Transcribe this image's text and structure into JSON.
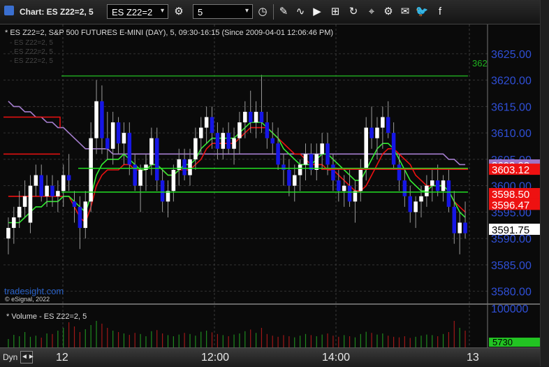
{
  "window": {
    "title": "Chart: ES Z22=2, 5"
  },
  "toolbar": {
    "symbol_value": "ES Z22=2",
    "interval_value": "5",
    "dropdown_glyph": "▾"
  },
  "chart": {
    "header": "* ES Z22=2, S&P 500 FUTURES E-MINI (DAY), 5, 09:30-16:15 (Since 2009-04-01 12:06:46 PM)",
    "faded_studies": [
      "- ES Z22=2, 5",
      "- ES Z22=2, 5",
      "- ES Z22=2, 5"
    ],
    "watermark": "tradesight.com",
    "copyright": "© eSignal, 2022",
    "green_line_tag": "362",
    "volume_header": "* Volume - ES Z22=2, 5",
    "volume_axis_label": "100000",
    "volume_last": "5730"
  },
  "price_tags": [
    {
      "text": "3603.93",
      "bg": "#a074c4",
      "fg": "#ffffff",
      "value": 3603.93
    },
    {
      "text": "3603.12",
      "bg": "#ee1111",
      "fg": "#ffffff",
      "value": 3603.12
    },
    {
      "text": "3598.50",
      "bg": "#ee1111",
      "fg": "#ffffff",
      "value": 3598.5
    },
    {
      "text": "3596.47",
      "bg": "#ee1111",
      "fg": "#ffffff",
      "value": 3596.47
    },
    {
      "text": "3591.75",
      "bg": "#ffffff",
      "fg": "#000000",
      "value": 3591.75
    }
  ],
  "footer": {
    "dyn_label": "Dyn",
    "dyn_button": "◄►",
    "time_labels": [
      "12",
      "12:00",
      "14:00",
      "13"
    ]
  },
  "chart_data": {
    "type": "candlestick",
    "y_ticks": [
      "3625.00",
      "3620.00",
      "3615.00",
      "3610.00",
      "3605.00",
      "3600.00",
      "3595.00",
      "3590.00",
      "3585.00",
      "3580.00"
    ],
    "ylim": [
      3578.5,
      3627.5
    ],
    "green_levels": [
      3620.8,
      3603.3,
      3598.8
    ],
    "red_level": 3603.12,
    "candles": [
      [
        3590,
        3594,
        3587,
        3592
      ],
      [
        3592,
        3596,
        3589,
        3594
      ],
      [
        3594,
        3599,
        3592,
        3596
      ],
      [
        3596,
        3601,
        3594,
        3598
      ],
      [
        3593,
        3602,
        3591,
        3600
      ],
      [
        3600,
        3604,
        3598,
        3602
      ],
      [
        3602,
        3604,
        3597,
        3598
      ],
      [
        3598,
        3602,
        3596,
        3600
      ],
      [
        3600,
        3602,
        3596,
        3598
      ],
      [
        3598,
        3601,
        3595,
        3599
      ],
      [
        3599,
        3604,
        3596,
        3602
      ],
      [
        3602,
        3606,
        3599,
        3601
      ],
      [
        3597,
        3599,
        3593,
        3596
      ],
      [
        3596,
        3598,
        3588,
        3592
      ],
      [
        3592,
        3599,
        3590,
        3597
      ],
      [
        3597,
        3612,
        3595,
        3609
      ],
      [
        3609,
        3620,
        3606,
        3616
      ],
      [
        3616,
        3619,
        3606,
        3609
      ],
      [
        3609,
        3614,
        3605,
        3607
      ],
      [
        3607,
        3614,
        3604,
        3612
      ],
      [
        3612,
        3613,
        3606,
        3608
      ],
      [
        3608,
        3612,
        3604,
        3610
      ],
      [
        3610,
        3612,
        3602,
        3604
      ],
      [
        3604,
        3606,
        3599,
        3600
      ],
      [
        3600,
        3604,
        3595,
        3603
      ],
      [
        3603,
        3606,
        3599,
        3604
      ],
      [
        3604,
        3611,
        3602,
        3609
      ],
      [
        3609,
        3611,
        3599,
        3601
      ],
      [
        3601,
        3603,
        3595,
        3597
      ],
      [
        3597,
        3601,
        3594,
        3599
      ],
      [
        3599,
        3604,
        3597,
        3603
      ],
      [
        3603,
        3607,
        3600,
        3605
      ],
      [
        3605,
        3607,
        3601,
        3602
      ],
      [
        3602,
        3607,
        3600,
        3605
      ],
      [
        3605,
        3611,
        3603,
        3609
      ],
      [
        3609,
        3613,
        3606,
        3611
      ],
      [
        3611,
        3615,
        3608,
        3613
      ],
      [
        3613,
        3615,
        3607,
        3610
      ],
      [
        3610,
        3612,
        3605,
        3607
      ],
      [
        3607,
        3611,
        3605,
        3610
      ],
      [
        3610,
        3612,
        3606,
        3607
      ],
      [
        3607,
        3611,
        3604,
        3609
      ],
      [
        3609,
        3614,
        3606,
        3612
      ],
      [
        3612,
        3616,
        3609,
        3614
      ],
      [
        3614,
        3618,
        3610,
        3612
      ],
      [
        3612,
        3616,
        3609,
        3614
      ],
      [
        3614,
        3621,
        3610,
        3612
      ],
      [
        3612,
        3614,
        3607,
        3609
      ],
      [
        3609,
        3612,
        3606,
        3608
      ],
      [
        3608,
        3611,
        3603,
        3604
      ],
      [
        3604,
        3606,
        3600,
        3603
      ],
      [
        3603,
        3605,
        3598,
        3600
      ],
      [
        3600,
        3604,
        3597,
        3602
      ],
      [
        3602,
        3605,
        3599,
        3604
      ],
      [
        3604,
        3608,
        3601,
        3606
      ],
      [
        3606,
        3608,
        3602,
        3603
      ],
      [
        3603,
        3608,
        3601,
        3606
      ],
      [
        3606,
        3610,
        3603,
        3608
      ],
      [
        3608,
        3610,
        3602,
        3604
      ],
      [
        3604,
        3606,
        3599,
        3601
      ],
      [
        3601,
        3603,
        3597,
        3599
      ],
      [
        3599,
        3602,
        3596,
        3600
      ],
      [
        3600,
        3603,
        3596,
        3597
      ],
      [
        3597,
        3601,
        3593,
        3599
      ],
      [
        3599,
        3605,
        3597,
        3603
      ],
      [
        3603,
        3613,
        3601,
        3611
      ],
      [
        3611,
        3615,
        3607,
        3609
      ],
      [
        3609,
        3613,
        3605,
        3611
      ],
      [
        3611,
        3615,
        3607,
        3613
      ],
      [
        3613,
        3616,
        3609,
        3610
      ],
      [
        3610,
        3612,
        3603,
        3604
      ],
      [
        3604,
        3606,
        3599,
        3601
      ],
      [
        3601,
        3603,
        3596,
        3598
      ],
      [
        3598,
        3600,
        3593,
        3595
      ],
      [
        3595,
        3598,
        3592,
        3597
      ],
      [
        3597,
        3600,
        3594,
        3598
      ],
      [
        3598,
        3602,
        3596,
        3600
      ],
      [
        3600,
        3603,
        3597,
        3601
      ],
      [
        3601,
        3604,
        3598,
        3599
      ],
      [
        3599,
        3602,
        3597,
        3601
      ],
      [
        3601,
        3603,
        3595,
        3596
      ],
      [
        3596,
        3599,
        3589,
        3591
      ],
      [
        3591,
        3595,
        3587,
        3593
      ],
      [
        3593,
        3597,
        3590,
        3591
      ]
    ],
    "red_ma": [
      3598,
      3598,
      3598,
      3598,
      3598,
      3598,
      3598,
      3598,
      3598,
      3598,
      3598,
      3598,
      3596,
      3594,
      3593,
      3596,
      3600,
      3602,
      3603,
      3603,
      3603,
      3604,
      3604,
      3603,
      3603,
      3603,
      3604,
      3604,
      3603,
      3602,
      3602,
      3603,
      3603,
      3603,
      3604,
      3605,
      3607,
      3608,
      3608,
      3608,
      3608,
      3608,
      3609,
      3610,
      3611,
      3611,
      3611,
      3611,
      3610,
      3609,
      3608,
      3607,
      3606,
      3606,
      3605,
      3604,
      3604,
      3604,
      3603,
      3603,
      3602,
      3601,
      3600,
      3599,
      3599,
      3600,
      3602,
      3604,
      3606,
      3607,
      3607,
      3606,
      3605,
      3604,
      3602,
      3601,
      3600,
      3600,
      3600,
      3600,
      3599,
      3597,
      3596,
      3595
    ],
    "green_ma": [
      3593,
      3593,
      3593,
      3594,
      3595,
      3596,
      3596,
      3597,
      3597,
      3597,
      3598,
      3598,
      3597,
      3596,
      3595,
      3598,
      3602,
      3604,
      3605,
      3605,
      3605,
      3606,
      3605,
      3604,
      3603,
      3603,
      3604,
      3604,
      3603,
      3602,
      3602,
      3603,
      3604,
      3604,
      3605,
      3607,
      3608,
      3609,
      3609,
      3609,
      3609,
      3609,
      3610,
      3611,
      3612,
      3612,
      3612,
      3611,
      3610,
      3609,
      3607,
      3606,
      3605,
      3604,
      3604,
      3604,
      3605,
      3606,
      3606,
      3605,
      3604,
      3603,
      3602,
      3601,
      3601,
      3603,
      3605,
      3607,
      3608,
      3608,
      3607,
      3605,
      3603,
      3601,
      3600,
      3599,
      3599,
      3600,
      3600,
      3600,
      3599,
      3597,
      3595,
      3594
    ],
    "purple_ma": [
      3616,
      3615,
      3615,
      3614,
      3614,
      3613,
      3613,
      3612,
      3612,
      3611,
      3611,
      3610,
      3609,
      3608,
      3607,
      3607,
      3607,
      3607,
      3607,
      3606,
      3606,
      3606,
      3606,
      3606,
      3606,
      3606,
      3606,
      3606,
      3606,
      3606,
      3606,
      3606,
      3606,
      3606,
      3606,
      3606,
      3606,
      3606,
      3606,
      3606,
      3606,
      3606,
      3606,
      3606,
      3606,
      3606,
      3606,
      3606,
      3606,
      3606,
      3606,
      3606,
      3606,
      3606,
      3606,
      3606,
      3606,
      3606,
      3606,
      3606,
      3606,
      3606,
      3606,
      3606,
      3606,
      3606,
      3606,
      3606,
      3606,
      3606,
      3606,
      3606,
      3606,
      3606,
      3606,
      3606,
      3606,
      3606,
      3606,
      3606,
      3605,
      3605,
      3604,
      3604
    ],
    "volume": [
      30,
      45,
      40,
      55,
      38,
      42,
      35,
      50,
      48,
      60,
      70,
      90,
      75,
      55,
      65,
      80,
      95,
      85,
      70,
      60,
      55,
      50,
      45,
      52,
      48,
      40,
      58,
      62,
      50,
      44,
      40,
      46,
      52,
      48,
      42,
      56,
      60,
      54,
      48,
      44,
      40,
      46,
      50,
      58,
      64,
      52,
      70,
      48,
      42,
      38,
      44,
      40,
      36,
      42,
      48,
      44,
      40,
      46,
      50,
      42,
      38,
      44,
      40,
      36,
      48,
      56,
      52,
      46,
      50,
      42,
      38,
      36,
      40,
      34,
      38,
      42,
      46,
      44,
      40,
      48,
      55,
      95,
      70,
      60
    ]
  }
}
